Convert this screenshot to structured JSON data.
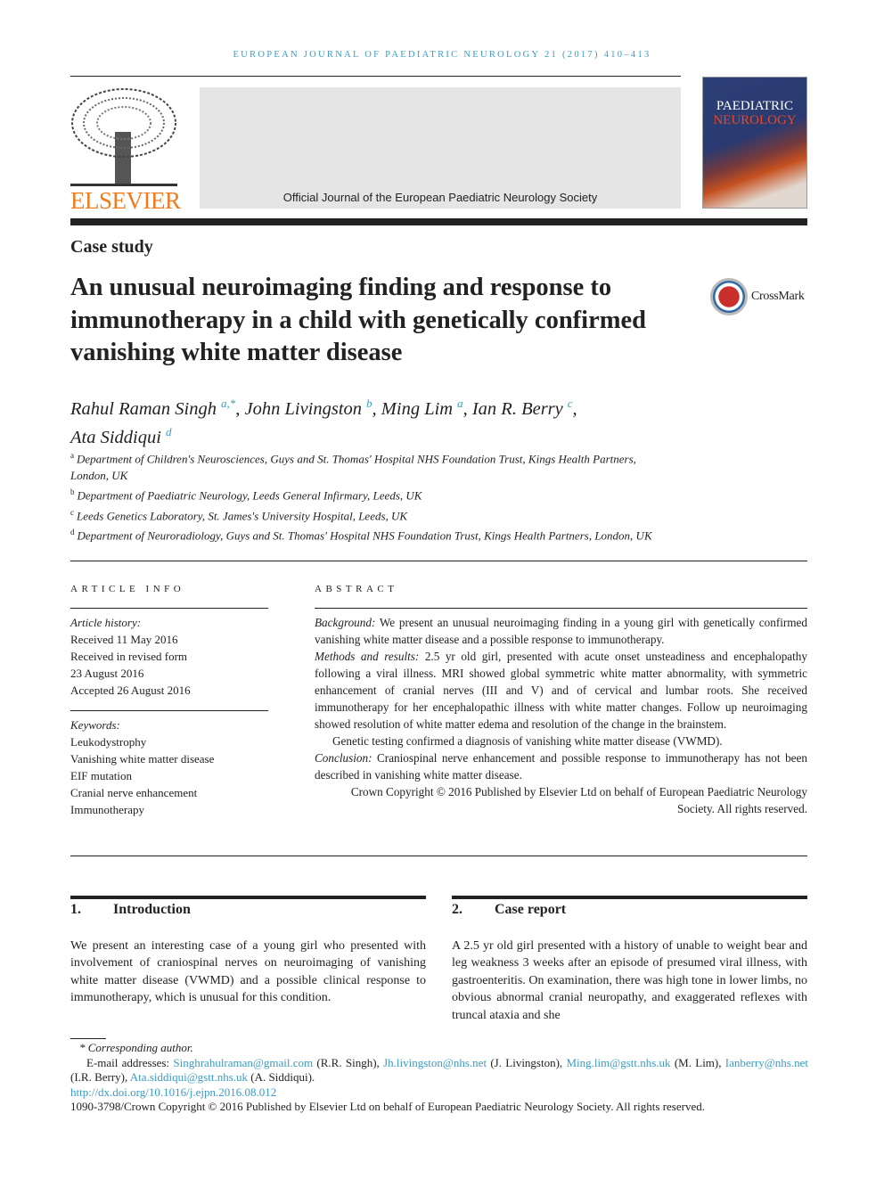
{
  "running_header": "EUROPEAN JOURNAL OF PAEDIATRIC NEUROLOGY 21 (2017) 410–413",
  "publisher_logo": "ELSEVIER",
  "banner_text": "Official Journal of the European Paediatric Neurology Society",
  "cover": {
    "line1": "PAEDIATRIC",
    "line2": "NEUROLOGY"
  },
  "section_label": "Case study",
  "title": "An unusual neuroimaging finding and response to immunotherapy in a child with genetically confirmed vanishing white matter disease",
  "crossmark": "CrossMark",
  "authors": [
    {
      "name": "Rahul Raman Singh",
      "sup": "a,*",
      "sep": ", "
    },
    {
      "name": "John Livingston",
      "sup": "b",
      "sep": ", "
    },
    {
      "name": "Ming Lim",
      "sup": "a",
      "sep": ", "
    },
    {
      "name": "Ian R. Berry",
      "sup": "c",
      "sep": ","
    },
    {
      "name": "Ata Siddiqui",
      "sup": "d",
      "sep": ""
    }
  ],
  "affiliations": [
    {
      "sup": "a",
      "text": "Department of Children's Neurosciences, Guys and St. Thomas' Hospital NHS Foundation Trust, Kings Health Partners, London, UK"
    },
    {
      "sup": "b",
      "text": "Department of Paediatric Neurology, Leeds General Infirmary, Leeds, UK"
    },
    {
      "sup": "c",
      "text": "Leeds Genetics Laboratory, St. James's University Hospital, Leeds, UK"
    },
    {
      "sup": "d",
      "text": "Department of Neuroradiology, Guys and St. Thomas' Hospital NHS Foundation Trust, Kings Health Partners, London, UK"
    }
  ],
  "article_info": {
    "heading": "ARTICLE INFO",
    "history_label": "Article history:",
    "history": [
      "Received 11 May 2016",
      "Received in revised form",
      "23 August 2016",
      "Accepted 26 August 2016"
    ],
    "keywords_label": "Keywords:",
    "keywords": [
      "Leukodystrophy",
      "Vanishing white matter disease",
      "EIF mutation",
      "Cranial nerve enhancement",
      "Immunotherapy"
    ]
  },
  "abstract": {
    "heading": "ABSTRACT",
    "background_label": "Background:",
    "background": " We present an unusual neuroimaging finding in a young girl with genetically confirmed vanishing white matter disease and a possible response to immunotherapy.",
    "methods_label": "Methods and results:",
    "methods": " 2.5 yr old girl, presented with acute onset unsteadiness and encephalopathy following a viral illness. MRI showed global symmetric white matter abnormality, with symmetric enhancement of cranial nerves (III and V) and of cervical and lumbar roots. She received immunotherapy for her encephalopathic illness with white matter changes. Follow up neuroimaging showed resolution of white matter edema and resolution of the change in the brainstem.",
    "genetic": "Genetic testing confirmed a diagnosis of vanishing white matter disease (VWMD).",
    "conclusion_label": "Conclusion:",
    "conclusion": " Craniospinal nerve enhancement and possible response to immunotherapy has not been described in vanishing white matter disease.",
    "copyright": "Crown Copyright © 2016 Published by Elsevier Ltd on behalf of European Paediatric Neurology Society. All rights reserved."
  },
  "sections": [
    {
      "number": "1.",
      "title": "Introduction",
      "text": "We present an interesting case of a young girl who presented with involvement of craniospinal nerves on neuroimaging of vanishing white matter disease (VWMD) and a possible clinical response to immunotherapy, which is unusual for this condition."
    },
    {
      "number": "2.",
      "title": "Case report",
      "text": "A 2.5 yr old girl presented with a history of unable to weight bear and leg weakness 3 weeks after an episode of presumed viral illness, with gastroenteritis. On examination, there was high tone in lower limbs, no obvious abnormal cranial neuropathy, and exaggerated reflexes with truncal ataxia and she"
    }
  ],
  "footnote": {
    "corresponding": "* Corresponding author.",
    "email_label": "E-mail addresses: ",
    "emails": [
      {
        "email": "Singhrahulraman@gmail.com",
        "who": " (R.R. Singh), "
      },
      {
        "email": "Jh.livingston@nhs.net",
        "who": " (J. Livingston), "
      },
      {
        "email": "Ming.lim@gstt.nhs.uk",
        "who": " (M. Lim), "
      },
      {
        "email": "Ianberry@nhs.net",
        "who": " (I.R. Berry), "
      },
      {
        "email": "Ata.siddiqui@gstt.nhs.uk",
        "who": " (A. Siddiqui)."
      }
    ],
    "doi": "http://dx.doi.org/10.1016/j.ejpn.2016.08.012",
    "copyright": "1090-3798/Crown Copyright © 2016 Published by Elsevier Ltd on behalf of European Paediatric Neurology Society. All rights reserved."
  },
  "colors": {
    "link": "#3a9cc4",
    "elsevier_orange": "#f07b1f"
  }
}
